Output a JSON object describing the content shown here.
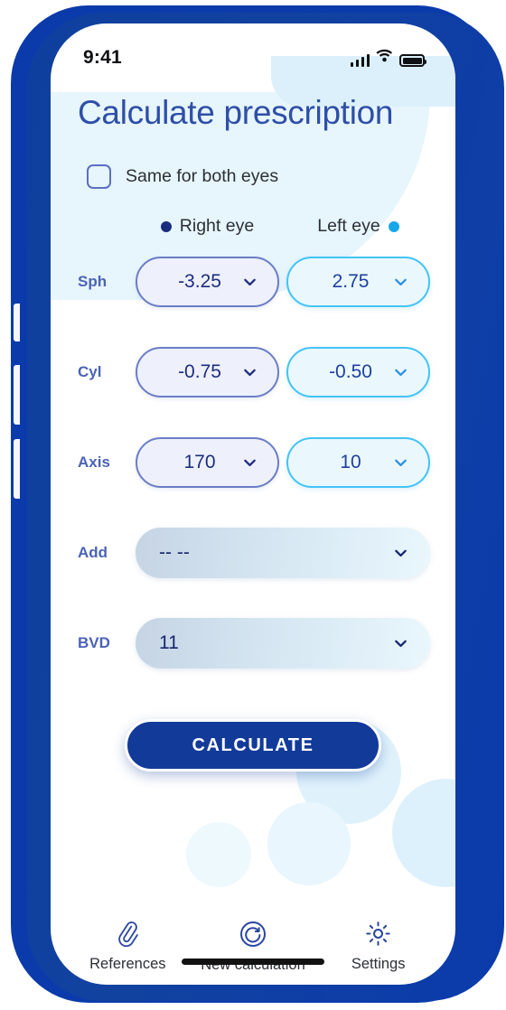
{
  "device": {
    "bezel_color": "#0b3bab",
    "status_bar": {
      "time": "9:41",
      "signal_icon": "signal-bars-icon",
      "wifi_icon": "wifi-icon",
      "battery_icon": "battery-full-icon"
    },
    "home_indicator": "home-indicator"
  },
  "theme": {
    "title_blue": "#2e4fa8",
    "right_eye_accent": "#192c7e",
    "left_eye_accent": "#17a8e8",
    "button_blue": "#123a99",
    "label_blue": "#4b63b5"
  },
  "header": {
    "title": "Calculate prescription"
  },
  "options": {
    "same_both_eyes": {
      "label": "Same for both eyes",
      "checked": false
    }
  },
  "columns": [
    {
      "key": "right",
      "label": "Right eye",
      "dot": "right-eye-dot",
      "dot_position": "before"
    },
    {
      "key": "left",
      "label": "Left eye",
      "dot": "left-eye-dot",
      "dot_position": "after"
    }
  ],
  "fields": [
    {
      "label": "Sph",
      "type": "dual",
      "right": {
        "value": "-3.25",
        "chevron": "chevron-down-icon"
      },
      "left": {
        "value": "2.75",
        "chevron": "chevron-down-icon"
      }
    },
    {
      "label": "Cyl",
      "type": "dual",
      "right": {
        "value": "-0.75",
        "chevron": "chevron-down-icon"
      },
      "left": {
        "value": "-0.50",
        "chevron": "chevron-down-icon"
      }
    },
    {
      "label": "Axis",
      "type": "dual",
      "right": {
        "value": "170",
        "chevron": "chevron-down-icon"
      },
      "left": {
        "value": "10",
        "chevron": "chevron-down-icon"
      }
    },
    {
      "label": "Add",
      "type": "single",
      "single": {
        "value": "-- --",
        "placeholder": "-- --",
        "chevron": "chevron-down-icon"
      }
    },
    {
      "label": "BVD",
      "type": "single",
      "single": {
        "value": "11",
        "placeholder": "-- --",
        "chevron": "chevron-down-icon"
      }
    }
  ],
  "primary_action": {
    "label": "CALCULATE"
  },
  "tabbar": [
    {
      "label": "References",
      "icon": "paperclip-icon",
      "active": false
    },
    {
      "label": "New calculation",
      "icon": "reset-circle-icon",
      "active": true
    },
    {
      "label": "Settings",
      "icon": "gear-icon",
      "active": false
    }
  ]
}
